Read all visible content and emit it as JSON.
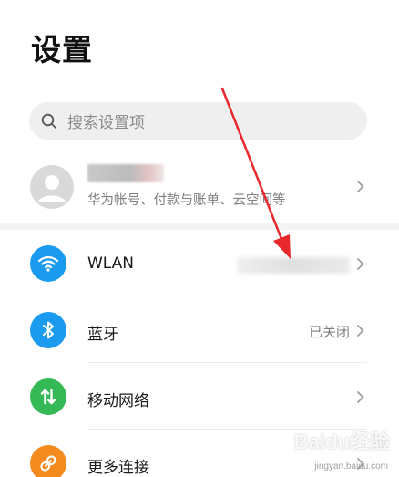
{
  "header": {
    "title": "设置"
  },
  "search": {
    "placeholder": "搜索设置项"
  },
  "account": {
    "subtitle": "华为帐号、付款与账单、云空间等"
  },
  "items": [
    {
      "label": "WLAN",
      "value": "",
      "icon": "wifi-icon",
      "color": "#1a9bf0"
    },
    {
      "label": "蓝牙",
      "value": "已关闭",
      "icon": "bluetooth-icon",
      "color": "#1a9bf0"
    },
    {
      "label": "移动网络",
      "value": "",
      "icon": "mobile-data-icon",
      "color": "#35b957"
    },
    {
      "label": "更多连接",
      "value": "",
      "icon": "link-icon",
      "color": "#f58a1f"
    }
  ],
  "annotation": {
    "color": "#e8282b"
  },
  "watermark": {
    "brand": "Baidu经验",
    "url": "jingyan.baidu.com"
  }
}
